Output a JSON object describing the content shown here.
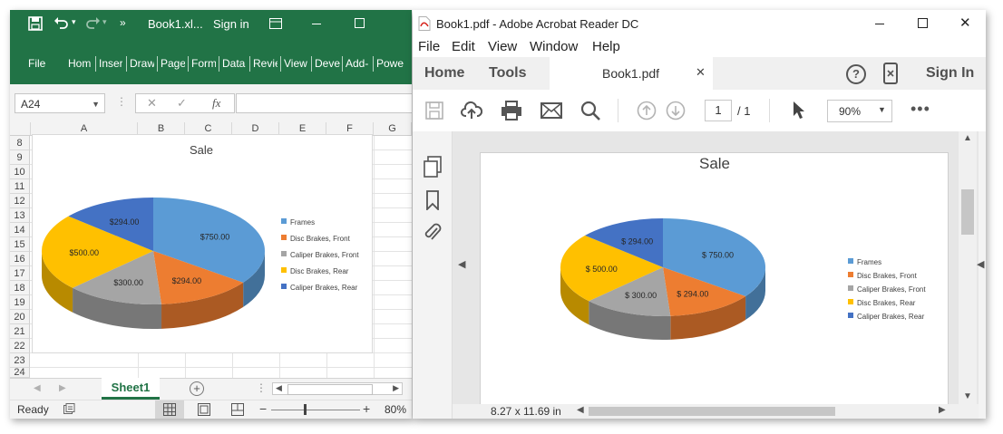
{
  "excel": {
    "title": "Book1.xl...",
    "sign_in": "Sign in",
    "ribbon_tabs": [
      "File",
      "Hom",
      "Inser",
      "Draw",
      "Page",
      "Form",
      "Data",
      "Revie",
      "View",
      "Deve",
      "Add-",
      "Powe"
    ],
    "name_box": "A24",
    "fx": "fx",
    "columns": [
      "A",
      "B",
      "C",
      "D",
      "E",
      "F",
      "G"
    ],
    "rows": [
      "8",
      "9",
      "10",
      "11",
      "12",
      "13",
      "14",
      "15",
      "16",
      "17",
      "18",
      "19",
      "20",
      "21",
      "22",
      "23",
      "24"
    ],
    "sheet_tab": "Sheet1",
    "status_ready": "Ready",
    "zoom": "80%"
  },
  "acrobat": {
    "title": "Book1.pdf - Adobe Acrobat Reader DC",
    "menu": [
      "File",
      "Edit",
      "View",
      "Window",
      "Help"
    ],
    "tab_home": "Home",
    "tab_tools": "Tools",
    "doc_tab": "Book1.pdf",
    "sign_in": "Sign In",
    "page_current": "1",
    "page_total": "/ 1",
    "zoom": "90%",
    "page_size": "8.27 x 11.69 in"
  },
  "chart_data": {
    "type": "pie",
    "title": "Sale",
    "categories": [
      "Frames",
      "Disc Brakes, Front",
      "Caliper Brakes, Front",
      "Disc Brakes, Rear",
      "Caliper Brakes, Rear"
    ],
    "values": [
      750,
      294,
      300,
      500,
      294
    ],
    "excel_labels": [
      "$750.00",
      "$294.00",
      "$300.00",
      "$500.00",
      "$294.00"
    ],
    "pdf_labels": [
      "$ 750.00",
      "$ 294.00",
      "$ 300.00",
      "$ 500.00",
      "$ 294.00"
    ],
    "colors": [
      "#5b9bd5",
      "#ed7d31",
      "#a5a5a5",
      "#ffc000",
      "#4472c4"
    ],
    "legend_position": "right",
    "style": "3-D pie"
  }
}
